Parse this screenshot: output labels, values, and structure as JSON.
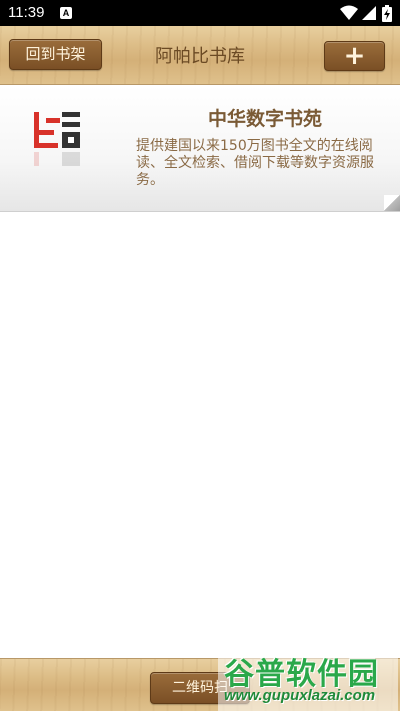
{
  "status_bar": {
    "time": "11:39",
    "notification_letter": "A"
  },
  "header": {
    "back_label": "回到书架",
    "title": "阿帕比书库",
    "add_label": "+"
  },
  "library": {
    "name": "中华数字书苑",
    "description": "提供建国以来150万图书全文的在线阅读、全文检索、借阅下载等数字资源服务。"
  },
  "footer": {
    "scan_label": "二维码扫"
  },
  "watermark": {
    "brand": "谷普软件园",
    "url": "www.gupuxlazai.com"
  },
  "colors": {
    "wood_button": "#7a4f25",
    "title_brown": "#6b4a24",
    "watermark_green": "#2aa84a"
  }
}
